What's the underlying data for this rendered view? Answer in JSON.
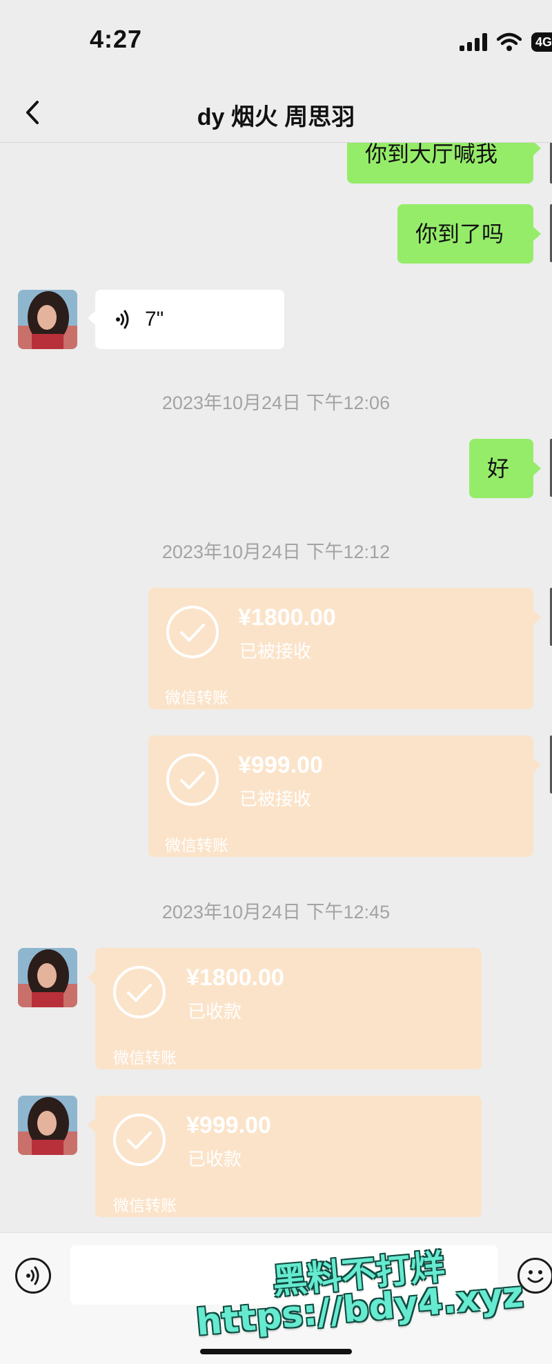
{
  "status_bar": {
    "time": "4:27",
    "battery_label": "4G",
    "icons": [
      "signal-icon",
      "wifi-icon",
      "battery-icon"
    ]
  },
  "nav": {
    "title": "dy 烟火 周思羽",
    "back_icon": "chevron-left-icon"
  },
  "messages": [
    {
      "side": "right",
      "type": "text",
      "text": "你到大厅喊我"
    },
    {
      "side": "right",
      "type": "text",
      "text": "你到了吗"
    },
    {
      "side": "left",
      "type": "voice",
      "duration": "7\""
    }
  ],
  "timestamps": [
    "2023年10月24日 下午12:06",
    "2023年10月24日 下午12:12",
    "2023年10月24日 下午12:45"
  ],
  "reply": {
    "side": "right",
    "type": "text",
    "text": "好"
  },
  "sent_transfers": [
    {
      "amount": "¥1800.00",
      "status": "已被接收",
      "source": "微信转账"
    },
    {
      "amount": "¥999.00",
      "status": "已被接收",
      "source": "微信转账"
    }
  ],
  "received_transfers": [
    {
      "amount": "¥1800.00",
      "status": "已收款",
      "source": "微信转账"
    },
    {
      "amount": "¥999.00",
      "status": "已收款",
      "source": "微信转账"
    }
  ],
  "input_bar": {
    "placeholder": "",
    "icons": [
      "voice-icon",
      "emoji-icon"
    ]
  },
  "watermark": {
    "line1": "黑料不打烊",
    "line2": "https://bdy4.xyz"
  },
  "colors": {
    "background": "#ededed",
    "sent_bubble": "#95ec69",
    "received_bubble": "#ffffff",
    "transfer_card": "#fbe3c9",
    "timestamp_text": "#a3a3a3",
    "watermark_fill": "#66ead0"
  }
}
